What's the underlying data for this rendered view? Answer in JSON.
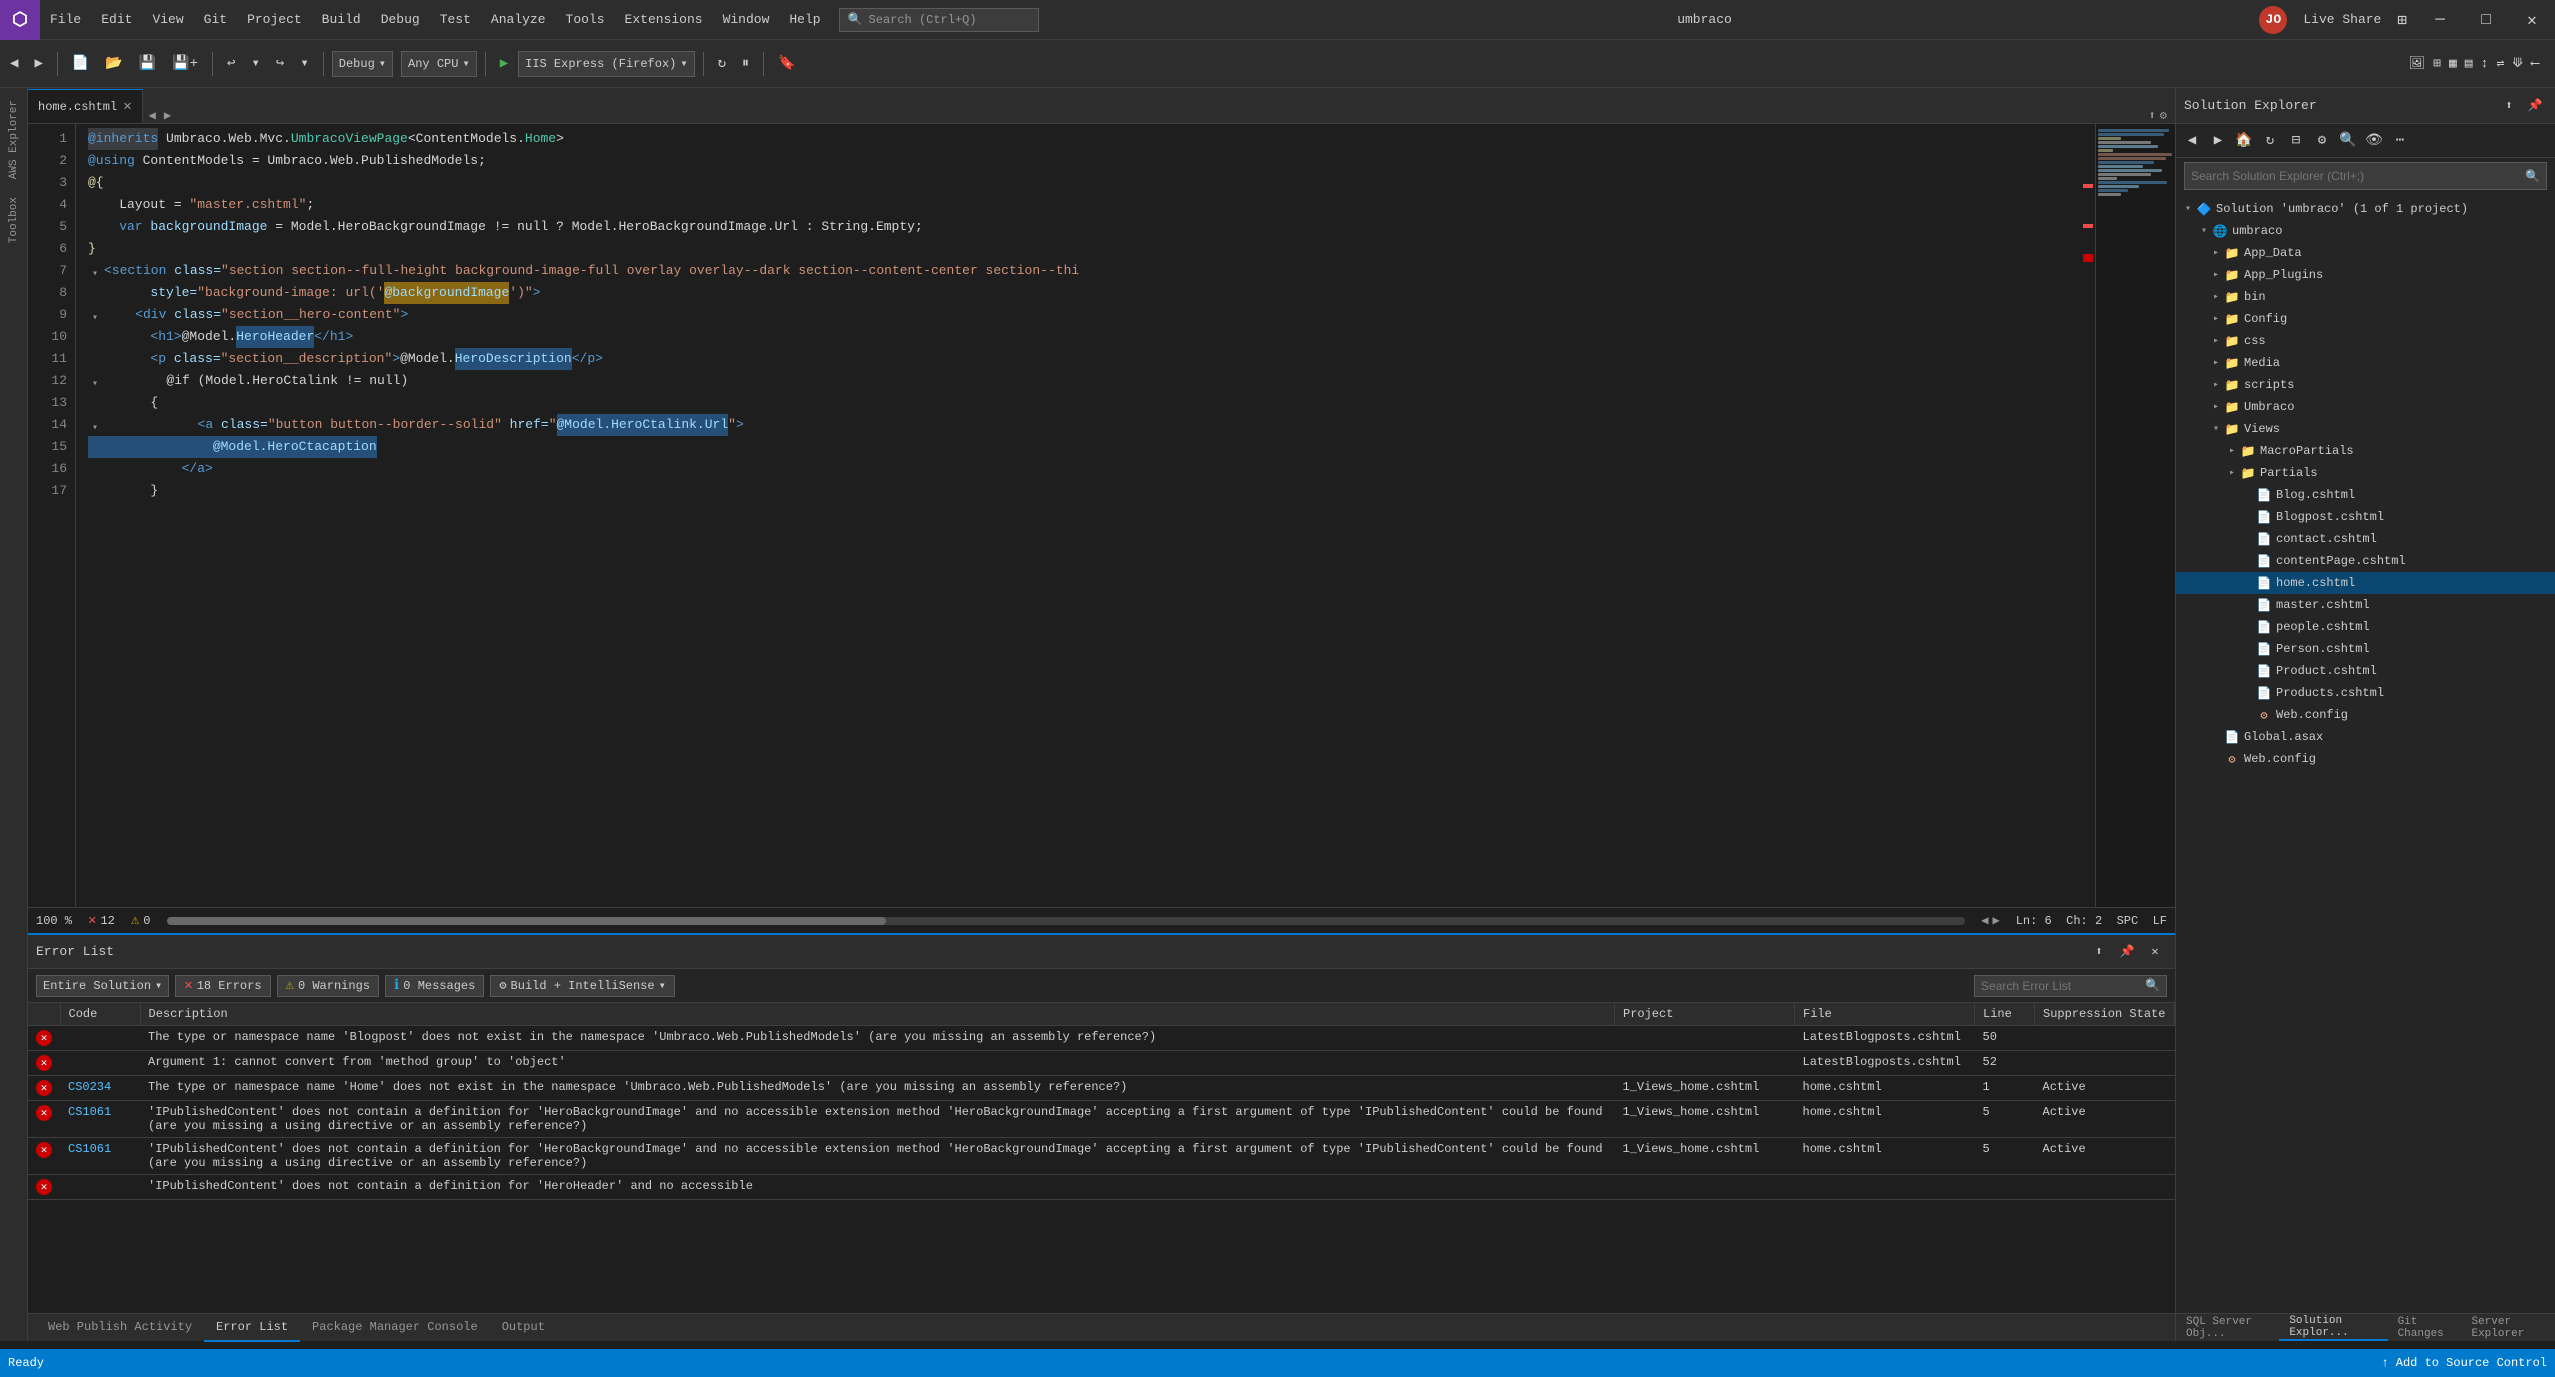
{
  "titlebar": {
    "logo": "⬡",
    "menu_items": [
      "File",
      "Edit",
      "View",
      "Git",
      "Project",
      "Build",
      "Debug",
      "Test",
      "Analyze",
      "Tools",
      "Extensions",
      "Window",
      "Help"
    ],
    "search_placeholder": "Search (Ctrl+Q)",
    "project_name": "umbraco",
    "live_share_label": "Live Share",
    "minimize_icon": "─",
    "maximize_icon": "□",
    "close_icon": "✕"
  },
  "toolbar": {
    "debug_config": "Debug",
    "platform": "Any CPU",
    "run_label": "IIS Express (Firefox)",
    "nav_back": "◀",
    "nav_forward": "▶"
  },
  "editor": {
    "tab_label": "home.cshtml",
    "tab_close": "✕",
    "lines": [
      {
        "num": 1,
        "tokens": [
          {
            "text": "@inherits",
            "class": "highlight-gray kw-blue"
          },
          {
            "text": " Umbraco.Web.Mvc.",
            "class": "kw-white"
          },
          {
            "text": "UmbracoViewPage",
            "class": "kw-green"
          },
          {
            "text": "<ContentModels.",
            "class": "kw-white"
          },
          {
            "text": "Home",
            "class": "kw-green"
          },
          {
            "text": ">",
            "class": "kw-white"
          }
        ]
      },
      {
        "num": 2,
        "tokens": [
          {
            "text": "@using",
            "class": "kw-blue"
          },
          {
            "text": " ContentModels = Umbraco.Web.PublishedModels;",
            "class": "kw-white"
          }
        ]
      },
      {
        "num": 3,
        "tokens": [
          {
            "text": "@{",
            "class": "kw-yellow"
          }
        ]
      },
      {
        "num": 4,
        "tokens": [
          {
            "text": "    Layout = ",
            "class": "kw-white"
          },
          {
            "text": "\"master.cshtml\"",
            "class": "kw-orange"
          },
          {
            "text": ";",
            "class": "kw-white"
          }
        ]
      },
      {
        "num": 5,
        "tokens": [
          {
            "text": "    var ",
            "class": "kw-blue"
          },
          {
            "text": "backgroundImage",
            "class": "kw-light-blue"
          },
          {
            "text": " = Model.HeroBackgroundImage != null ? Model.HeroBackgroundImage.Url : String.Empty;",
            "class": "kw-white"
          }
        ]
      },
      {
        "num": 6,
        "tokens": [
          {
            "text": "}",
            "class": "kw-yellow"
          }
        ]
      },
      {
        "num": 7,
        "tokens": [
          {
            "text": "<section",
            "class": "kw-blue"
          },
          {
            "text": " class=",
            "class": "kw-light-blue"
          },
          {
            "text": "\"section section--full-height background-image-full overlay overlay--dark section--content-center section--thi",
            "class": "kw-orange"
          }
        ]
      },
      {
        "num": 8,
        "tokens": [
          {
            "text": "    style=",
            "class": "kw-light-blue"
          },
          {
            "text": "\"background-image: url('",
            "class": "kw-orange"
          },
          {
            "text": "@backgroundImage",
            "class": "highlight-yellow kw-light-blue"
          },
          {
            "text": "')\"",
            "class": "kw-orange"
          },
          {
            "text": ">",
            "class": "kw-blue"
          }
        ]
      },
      {
        "num": 9,
        "tokens": [
          {
            "text": "    <div",
            "class": "kw-blue"
          },
          {
            "text": " class=",
            "class": "kw-light-blue"
          },
          {
            "text": "\"section__hero-content\"",
            "class": "kw-orange"
          },
          {
            "text": ">",
            "class": "kw-blue"
          }
        ]
      },
      {
        "num": 10,
        "tokens": [
          {
            "text": "        <h1>",
            "class": "kw-blue"
          },
          {
            "text": "@Model.",
            "class": "kw-white"
          },
          {
            "text": "HeroHeader",
            "class": "highlight-blue kw-light-blue"
          },
          {
            "text": "</h1>",
            "class": "kw-blue"
          }
        ]
      },
      {
        "num": 11,
        "tokens": [
          {
            "text": "        <p",
            "class": "kw-blue"
          },
          {
            "text": " class=",
            "class": "kw-light-blue"
          },
          {
            "text": "\"section__description\"",
            "class": "kw-orange"
          },
          {
            "text": ">",
            "class": "kw-blue"
          },
          {
            "text": "@Model.",
            "class": "kw-white"
          },
          {
            "text": "HeroDescription",
            "class": "highlight-blue kw-light-blue"
          },
          {
            "text": "</p>",
            "class": "kw-blue"
          }
        ]
      },
      {
        "num": 12,
        "tokens": [
          {
            "text": "        @if (Model.HeroCtalink != null)",
            "class": "kw-white"
          }
        ]
      },
      {
        "num": 13,
        "tokens": [
          {
            "text": "        {",
            "class": "kw-white"
          }
        ]
      },
      {
        "num": 14,
        "tokens": [
          {
            "text": "            <a",
            "class": "kw-blue"
          },
          {
            "text": " class=",
            "class": "kw-light-blue"
          },
          {
            "text": "\"button button--border--solid\"",
            "class": "kw-orange"
          },
          {
            "text": " href=",
            "class": "kw-light-blue"
          },
          {
            "text": "\"",
            "class": "kw-orange"
          },
          {
            "text": "@Model.HeroCtalink.Url",
            "class": "highlight-blue kw-light-blue"
          },
          {
            "text": "\"",
            "class": "kw-orange"
          },
          {
            "text": ">",
            "class": "kw-blue"
          }
        ]
      },
      {
        "num": 15,
        "tokens": [
          {
            "text": "                @Model.HeroCtacaption",
            "class": "highlight-blue kw-light-blue"
          }
        ]
      },
      {
        "num": 16,
        "tokens": [
          {
            "text": "            </a>",
            "class": "kw-blue"
          }
        ]
      },
      {
        "num": 17,
        "tokens": [
          {
            "text": "        }",
            "class": "kw-white"
          }
        ]
      }
    ],
    "zoom_level": "100 %",
    "error_count": 12,
    "warning_count": 0,
    "line_number": "Ln: 6",
    "col_number": "Ch: 2",
    "encoding": "SPC",
    "line_ending": "LF"
  },
  "error_list": {
    "panel_title": "Error List",
    "filter_scope": "Entire Solution",
    "errors_label": "18 Errors",
    "warnings_label": "0 Warnings",
    "messages_label": "0 Messages",
    "build_filter": "Build + IntelliSense",
    "search_placeholder": "Search Error List",
    "columns": [
      "",
      "Code",
      "Description",
      "Project",
      "File",
      "Line",
      "Suppression State"
    ],
    "errors": [
      {
        "type": "error",
        "code": "",
        "description": "The type or namespace name 'Blogpost' does not exist in the namespace 'Umbraco.Web.PublishedModels' (are you missing an assembly reference?)",
        "project": "",
        "file": "LatestBlogposts.cshtml",
        "line": "50",
        "suppression": ""
      },
      {
        "type": "error",
        "code": "",
        "description": "Argument 1: cannot convert from 'method group' to 'object'",
        "project": "",
        "file": "LatestBlogposts.cshtml",
        "line": "52",
        "suppression": ""
      },
      {
        "type": "error",
        "code": "CS0234",
        "description": "The type or namespace name 'Home' does not exist in the namespace 'Umbraco.Web.PublishedModels' (are you missing an assembly reference?)",
        "project": "1_Views_home.cshtml",
        "file": "home.cshtml",
        "line": "1",
        "suppression": "Active"
      },
      {
        "type": "error",
        "code": "CS1061",
        "description": "'IPublishedContent' does not contain a definition for 'HeroBackgroundImage' and no accessible extension method 'HeroBackgroundImage' accepting a first argument of type 'IPublishedContent' could be found (are you missing a using directive or an assembly reference?)",
        "project": "1_Views_home.cshtml",
        "file": "home.cshtml",
        "line": "5",
        "suppression": "Active"
      },
      {
        "type": "error",
        "code": "CS1061",
        "description": "'IPublishedContent' does not contain a definition for 'HeroBackgroundImage' and no accessible extension method 'HeroBackgroundImage' accepting a first argument of type 'IPublishedContent' could be found (are you missing a using directive or an assembly reference?)",
        "project": "1_Views_home.cshtml",
        "file": "home.cshtml",
        "line": "5",
        "suppression": "Active"
      },
      {
        "type": "error",
        "code": "",
        "description": "'IPublishedContent' does not contain a definition for 'HeroHeader' and no accessible",
        "project": "",
        "file": "",
        "line": "",
        "suppression": ""
      }
    ]
  },
  "bottom_tabs": [
    {
      "label": "Web Publish Activity",
      "active": false
    },
    {
      "label": "Error List",
      "active": true
    },
    {
      "label": "Package Manager Console",
      "active": false
    },
    {
      "label": "Output",
      "active": false
    }
  ],
  "solution_explorer": {
    "title": "Solution Explorer",
    "search_placeholder": "Search Solution Explorer (Ctrl+;)",
    "solution_label": "Solution 'umbraco' (1 of 1 project)",
    "project_name": "umbraco",
    "tree_items": [
      {
        "label": "App_Data",
        "type": "folder",
        "indent": 2,
        "expanded": false
      },
      {
        "label": "App_Plugins",
        "type": "folder",
        "indent": 2,
        "expanded": false
      },
      {
        "label": "bin",
        "type": "folder",
        "indent": 2,
        "expanded": false
      },
      {
        "label": "Config",
        "type": "folder",
        "indent": 2,
        "expanded": false
      },
      {
        "label": "css",
        "type": "folder",
        "indent": 2,
        "expanded": false
      },
      {
        "label": "Media",
        "type": "folder",
        "indent": 2,
        "expanded": false
      },
      {
        "label": "scripts",
        "type": "folder",
        "indent": 2,
        "expanded": false
      },
      {
        "label": "Umbraco",
        "type": "folder",
        "indent": 2,
        "expanded": false
      },
      {
        "label": "Views",
        "type": "folder",
        "indent": 2,
        "expanded": true
      },
      {
        "label": "MacroPartials",
        "type": "folder",
        "indent": 3,
        "expanded": false
      },
      {
        "label": "Partials",
        "type": "folder",
        "indent": 3,
        "expanded": false
      },
      {
        "label": "Blog.cshtml",
        "type": "cshtml",
        "indent": 4,
        "expanded": false
      },
      {
        "label": "Blogpost.cshtml",
        "type": "cshtml",
        "indent": 4,
        "expanded": false
      },
      {
        "label": "contact.cshtml",
        "type": "cshtml",
        "indent": 4,
        "expanded": false
      },
      {
        "label": "contentPage.cshtml",
        "type": "cshtml",
        "indent": 4,
        "expanded": false
      },
      {
        "label": "home.cshtml",
        "type": "cshtml",
        "indent": 4,
        "expanded": false,
        "selected": true
      },
      {
        "label": "master.cshtml",
        "type": "cshtml",
        "indent": 4,
        "expanded": false
      },
      {
        "label": "people.cshtml",
        "type": "cshtml",
        "indent": 4,
        "expanded": false
      },
      {
        "label": "Person.cshtml",
        "type": "cshtml",
        "indent": 4,
        "expanded": false
      },
      {
        "label": "Product.cshtml",
        "type": "cshtml",
        "indent": 4,
        "expanded": false
      },
      {
        "label": "Products.cshtml",
        "type": "cshtml",
        "indent": 4,
        "expanded": false
      },
      {
        "label": "Web.config",
        "type": "config",
        "indent": 4,
        "expanded": false
      },
      {
        "label": "Global.asax",
        "type": "file",
        "indent": 2,
        "expanded": false
      },
      {
        "label": "Web.config",
        "type": "config",
        "indent": 2,
        "expanded": false
      }
    ]
  },
  "right_panel_tabs": [
    {
      "label": "SQL Server Obj...",
      "active": false
    },
    {
      "label": "Solution Explor...",
      "active": true
    },
    {
      "label": "Git Changes",
      "active": false
    },
    {
      "label": "Server Explorer",
      "active": false
    }
  ],
  "status_bar": {
    "ready_label": "Ready",
    "add_source_control": "Add to Source Control",
    "up_icon": "↑"
  }
}
